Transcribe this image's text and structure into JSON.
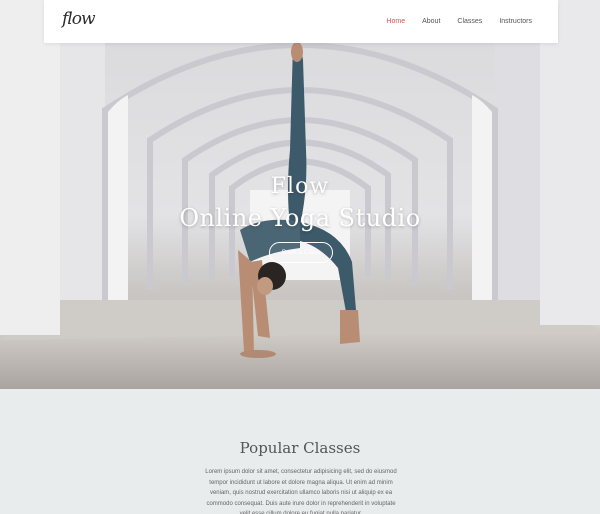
{
  "nav": {
    "logo": "flow",
    "links": [
      "Home",
      "About",
      "Classes",
      "Instructors"
    ],
    "active": "Home"
  },
  "hero": {
    "title_line1": "Flow",
    "title_line2": "Online Yoga Studio",
    "cta_label": "Book a Class"
  },
  "section": {
    "title": "Popular Classes",
    "text": "Lorem ipsum dolor sit amet, consectetur adipisicing elit, sed do eiusmod tempor incididunt ut labore et dolore magna aliqua. Ut enim ad minim veniam, quis nostrud exercitation ullamco laboris nisi ut aliquip ex ea commodo consequat. Duis aute irure dolor in reprehenderit in voluptate velit esse cillum dolore eu fugiat nulla pariatur."
  },
  "colors": {
    "accent": "#d9534f",
    "nav_bg": "#ffffff",
    "section_bg": "#e8ecec",
    "text_muted": "#666666"
  }
}
